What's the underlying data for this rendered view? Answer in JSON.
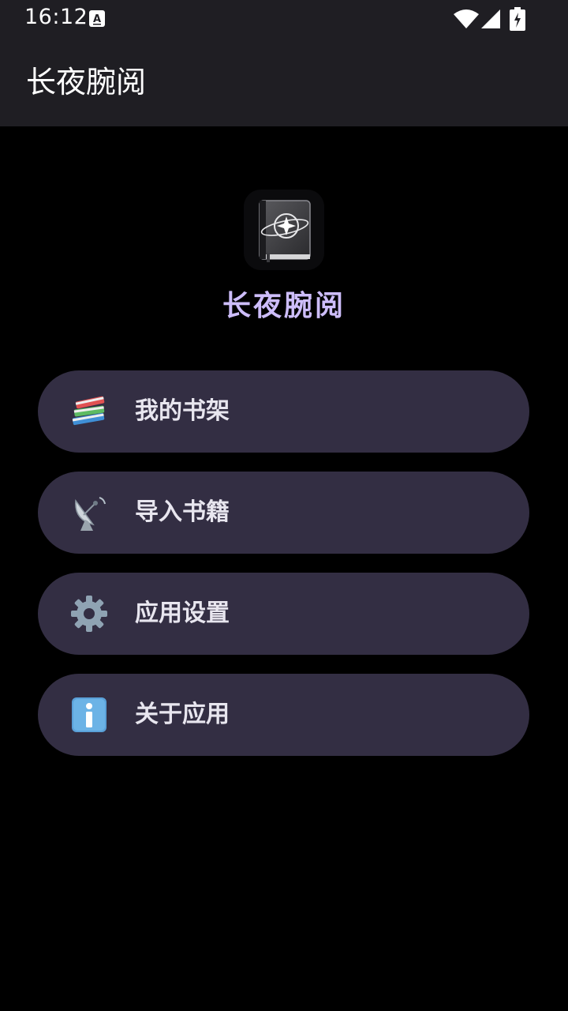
{
  "status_bar": {
    "time": "16:12",
    "icons": [
      "notification-a-icon",
      "wifi-icon",
      "signal-icon",
      "battery-charging-icon"
    ]
  },
  "app_bar": {
    "title": "长夜腕阅"
  },
  "hero": {
    "logo_icon": "book-planet-icon",
    "app_name": "长夜腕阅",
    "app_name_color": "#cdbdfa"
  },
  "menu": {
    "items": [
      {
        "label": "我的书架",
        "icon": "books-icon"
      },
      {
        "label": "导入书籍",
        "icon": "satellite-antenna-icon"
      },
      {
        "label": "应用设置",
        "icon": "gear-icon"
      },
      {
        "label": "关于应用",
        "icon": "info-icon"
      }
    ]
  },
  "colors": {
    "background": "#000000",
    "bars": "#1f1e23",
    "menu_button": "#332e43",
    "accent": "#cdbdfa"
  }
}
